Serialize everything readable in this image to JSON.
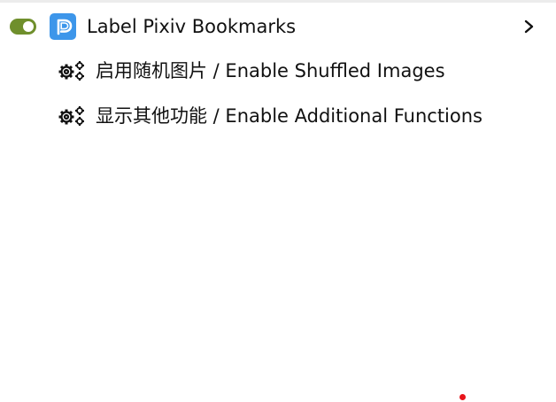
{
  "menu": {
    "main_item": {
      "label": "Label Pixiv Bookmarks",
      "toggle_state": "on",
      "toggle_color": "#6f8f2c",
      "app_icon": "pixiv-logo-icon",
      "app_icon_color": "#3d96ea",
      "submenu_icon": "chevron-right-icon"
    },
    "sub_items": [
      {
        "label": "启用随机图片 / Enable Shuffled Images",
        "icon": "gears-icon"
      },
      {
        "label": "显示其他功能 / Enable Additional Functions",
        "icon": "gears-icon"
      }
    ]
  },
  "cursor": {
    "color": "#e8141b"
  }
}
